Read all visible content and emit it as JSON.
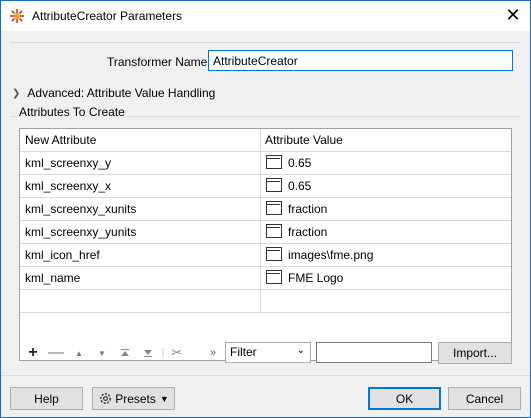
{
  "window": {
    "title": "AttributeCreator Parameters"
  },
  "form": {
    "transformer_name_label": "Transformer Name:",
    "transformer_name_value": "AttributeCreator"
  },
  "advanced": {
    "label": "Advanced: Attribute Value Handling"
  },
  "group": {
    "title": "Attributes To Create"
  },
  "table": {
    "headers": [
      "New Attribute",
      "Attribute Value"
    ],
    "rows": [
      {
        "name": "kml_screenxy_y",
        "value": "0.65"
      },
      {
        "name": "kml_screenxy_x",
        "value": "0.65"
      },
      {
        "name": "kml_screenxy_xunits",
        "value": "fraction"
      },
      {
        "name": "kml_screenxy_yunits",
        "value": "fraction"
      },
      {
        "name": "kml_icon_href",
        "value": "images\\fme.png"
      },
      {
        "name": "kml_name",
        "value": "FME Logo"
      }
    ]
  },
  "toolbar": {
    "filter_selected": "Filter",
    "import_label": "Import..."
  },
  "footer": {
    "help_label": "Help",
    "presets_label": "Presets",
    "ok_label": "OK",
    "cancel_label": "Cancel"
  }
}
